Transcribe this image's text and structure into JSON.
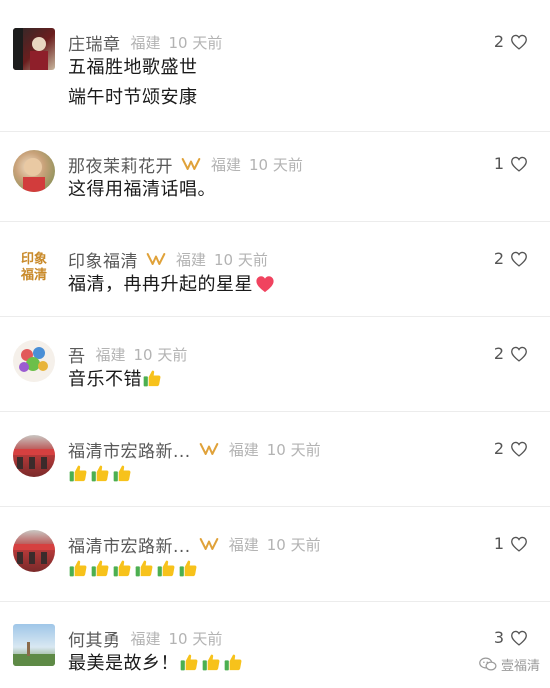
{
  "comments": [
    {
      "username": "庄瑞章",
      "vip": false,
      "location": "福建",
      "time": "10 天前",
      "text_lines": [
        "五福胜地歌盛世",
        "端午时节颂安康"
      ],
      "likes": "2",
      "thumbs": 0,
      "heart_emoji": false
    },
    {
      "username": "那夜茉莉花开",
      "vip": true,
      "location": "福建",
      "time": "10 天前",
      "text_lines": [
        "这得用福清话唱。"
      ],
      "likes": "1",
      "thumbs": 0,
      "heart_emoji": false
    },
    {
      "username": "印象福清",
      "vip": true,
      "location": "福建",
      "time": "10 天前",
      "text_lines": [
        "福清，冉冉升起的星星"
      ],
      "likes": "2",
      "thumbs": 0,
      "heart_emoji": true,
      "avatar_text": "印象福清"
    },
    {
      "username": "吾",
      "vip": false,
      "location": "福建",
      "time": "10 天前",
      "text_lines": [
        "音乐不错"
      ],
      "likes": "2",
      "thumbs": 1,
      "heart_emoji": false
    },
    {
      "username": "福清市宏路新...",
      "vip": true,
      "location": "福建",
      "time": "10 天前",
      "text_lines": [
        ""
      ],
      "likes": "2",
      "thumbs": 3,
      "heart_emoji": false
    },
    {
      "username": "福清市宏路新...",
      "vip": true,
      "location": "福建",
      "time": "10 天前",
      "text_lines": [
        ""
      ],
      "likes": "1",
      "thumbs": 6,
      "heart_emoji": false
    },
    {
      "username": "何其勇",
      "vip": false,
      "location": "福建",
      "time": "10 天前",
      "text_lines": [
        "最美是故乡！"
      ],
      "likes": "3",
      "thumbs": 3,
      "heart_emoji": false
    }
  ],
  "watermark": "壹福清",
  "icons": {
    "like": "heart-outline-icon",
    "vip": "vip-badge-icon",
    "thumb": "thumbs-up-emoji",
    "heart": "red-heart-emoji"
  },
  "colors": {
    "vip_gold": "#e0a23a",
    "heart_red": "#f0435f"
  }
}
